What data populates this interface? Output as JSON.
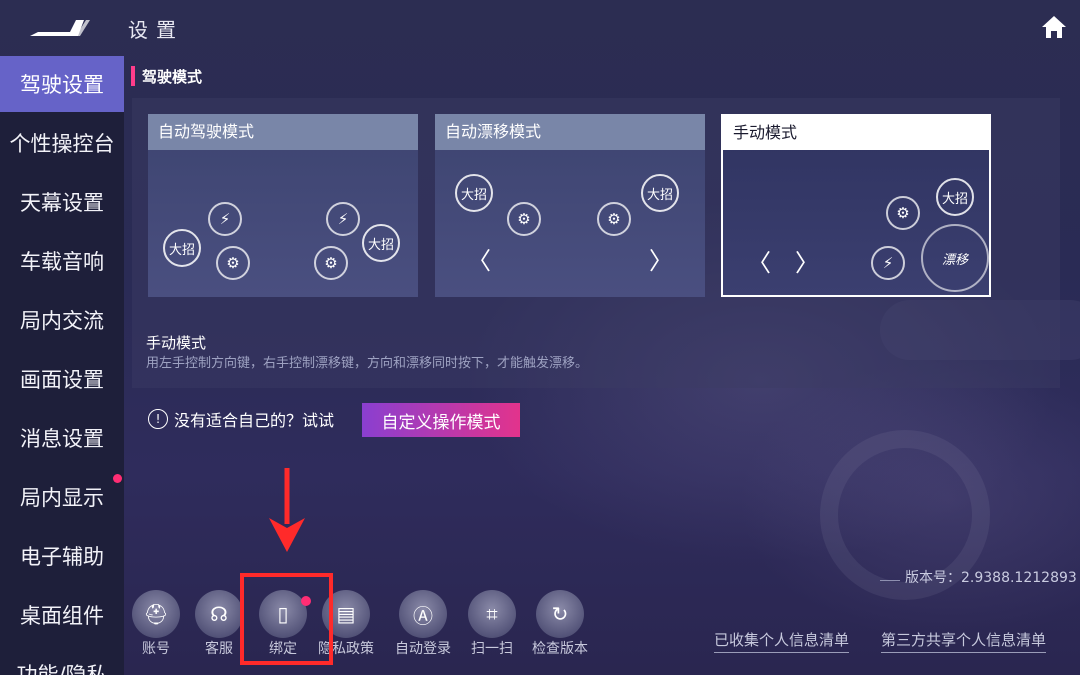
{
  "header": {
    "title": "设置"
  },
  "sidebar": {
    "items": [
      {
        "label": "驾驶设置",
        "active": true
      },
      {
        "label": "个性操控台"
      },
      {
        "label": "天幕设置"
      },
      {
        "label": "车载音响"
      },
      {
        "label": "局内交流"
      },
      {
        "label": "画面设置"
      },
      {
        "label": "消息设置"
      },
      {
        "label": "局内显示",
        "badge": true
      },
      {
        "label": "电子辅助"
      },
      {
        "label": "桌面组件"
      },
      {
        "label": "功能/隐私"
      }
    ]
  },
  "section": {
    "title": "驾驶模式"
  },
  "modes": [
    {
      "title": "自动驾驶模式",
      "buttons": {
        "ult1": "大招",
        "ult2": "大招"
      }
    },
    {
      "title": "自动漂移模式",
      "buttons": {
        "ult1": "大招",
        "ult2": "大招",
        "left": "〈",
        "right": "〉"
      }
    },
    {
      "title": "手动模式",
      "selected": true,
      "buttons": {
        "ult": "大招",
        "drift": "漂移",
        "left": "〈",
        "right": "〉"
      }
    }
  ],
  "description": {
    "title": "手动模式",
    "text": "用左手控制方向键，右手控制漂移键，方向和漂移同时按下，才能触发漂移。"
  },
  "hint": {
    "icon": "!",
    "text": "没有适合自己的？试试"
  },
  "custom_button": {
    "label": "自定义操作模式"
  },
  "version": {
    "text": "版本号：2.9388.1212893"
  },
  "toolbar": {
    "items": [
      {
        "label": "账号",
        "icon": "helmet-icon"
      },
      {
        "label": "客服",
        "icon": "headset-icon"
      },
      {
        "label": "绑定",
        "icon": "phone-icon",
        "badge": true,
        "highlighted": true
      },
      {
        "label": "隐私政策",
        "icon": "document-icon"
      },
      {
        "label": "自动登录",
        "icon": "helmet-auto-icon"
      },
      {
        "label": "扫一扫",
        "icon": "scan-icon"
      },
      {
        "label": "检查版本",
        "icon": "refresh-icon"
      }
    ]
  },
  "links": {
    "collected": "已收集个人信息清单",
    "shared": "第三方共享个人信息清单"
  },
  "colors": {
    "accent": "#6663c8",
    "highlight": "#ff2a2a",
    "badge": "#ff2d74",
    "button_gradient_start": "#8a3fd0",
    "button_gradient_end": "#e2338c"
  }
}
